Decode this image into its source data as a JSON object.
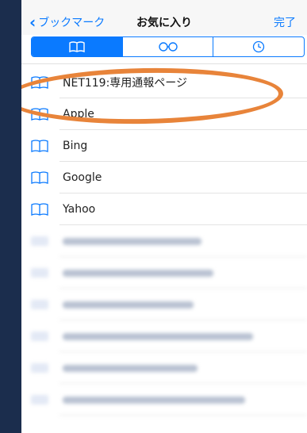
{
  "nav": {
    "back_label": "ブックマーク",
    "title": "お気に入り",
    "done_label": "完了"
  },
  "segments": [
    {
      "icon": "bookmarks-icon",
      "active": true
    },
    {
      "icon": "reading-list-icon",
      "active": false
    },
    {
      "icon": "history-icon",
      "active": false
    }
  ],
  "favorites": [
    {
      "label": "NET119:専用通報ページ"
    },
    {
      "label": "Apple"
    },
    {
      "label": "Bing"
    },
    {
      "label": "Google"
    },
    {
      "label": "Yahoo"
    }
  ],
  "colors": {
    "accent": "#0a7aff",
    "highlight": "#e8843a",
    "background": "#1b2d4d"
  }
}
